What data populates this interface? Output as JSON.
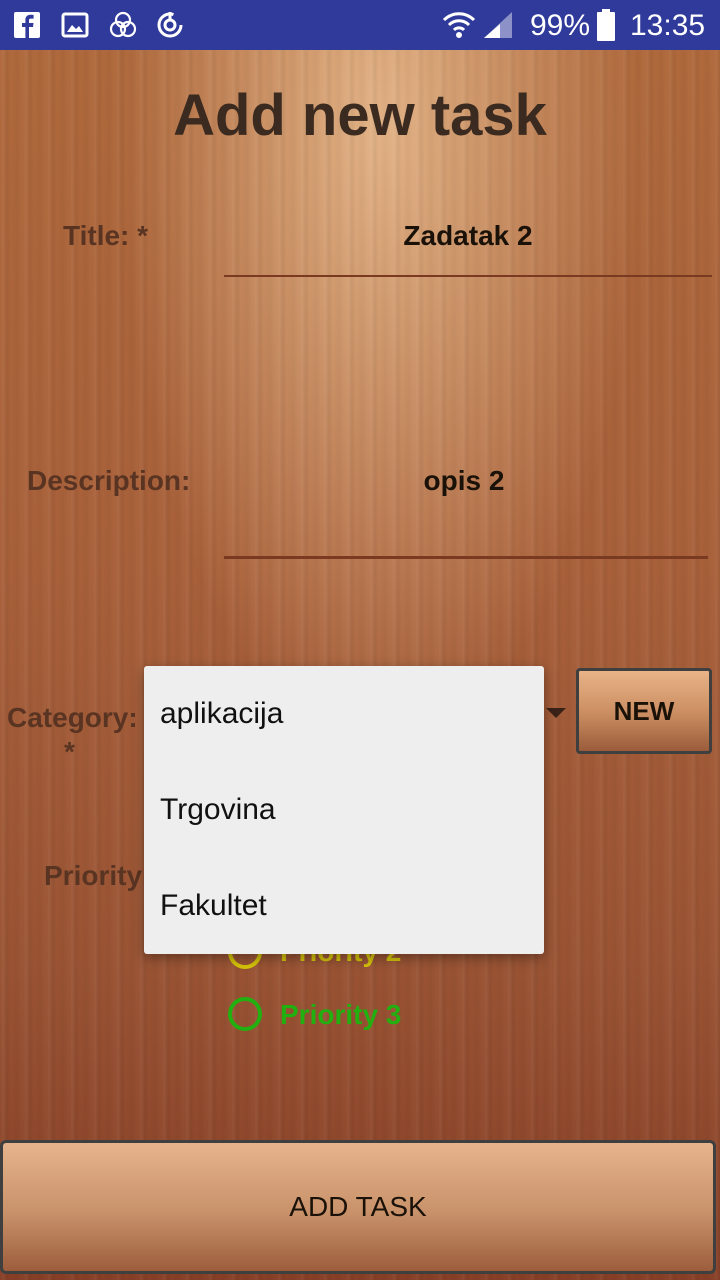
{
  "status_bar": {
    "icons": [
      "facebook-icon",
      "gallery-icon",
      "circles-icon",
      "sync-icon",
      "wifi-icon",
      "signal-icon",
      "battery-icon"
    ],
    "battery": "99%",
    "time": "13:35"
  },
  "page": {
    "title": "Add new task"
  },
  "form": {
    "title_label": "Title: *",
    "title_value": "Zadatak 2",
    "description_label": "Description:",
    "description_value": "opis 2",
    "category_label": "Category:",
    "category_required": "*",
    "new_button": "NEW",
    "priority_label": "Priority",
    "priorities": [
      {
        "label": "Priority 2",
        "color": "#d4c20a"
      },
      {
        "label": "Priority 3",
        "color": "#22b010"
      }
    ]
  },
  "dropdown": {
    "items": [
      "aplikacija",
      "Trgovina",
      "Fakultet"
    ]
  },
  "actions": {
    "add_task": "ADD TASK"
  },
  "colors": {
    "status_bar": "#2f3a9a",
    "dropdown_bg": "#eeeeee"
  }
}
